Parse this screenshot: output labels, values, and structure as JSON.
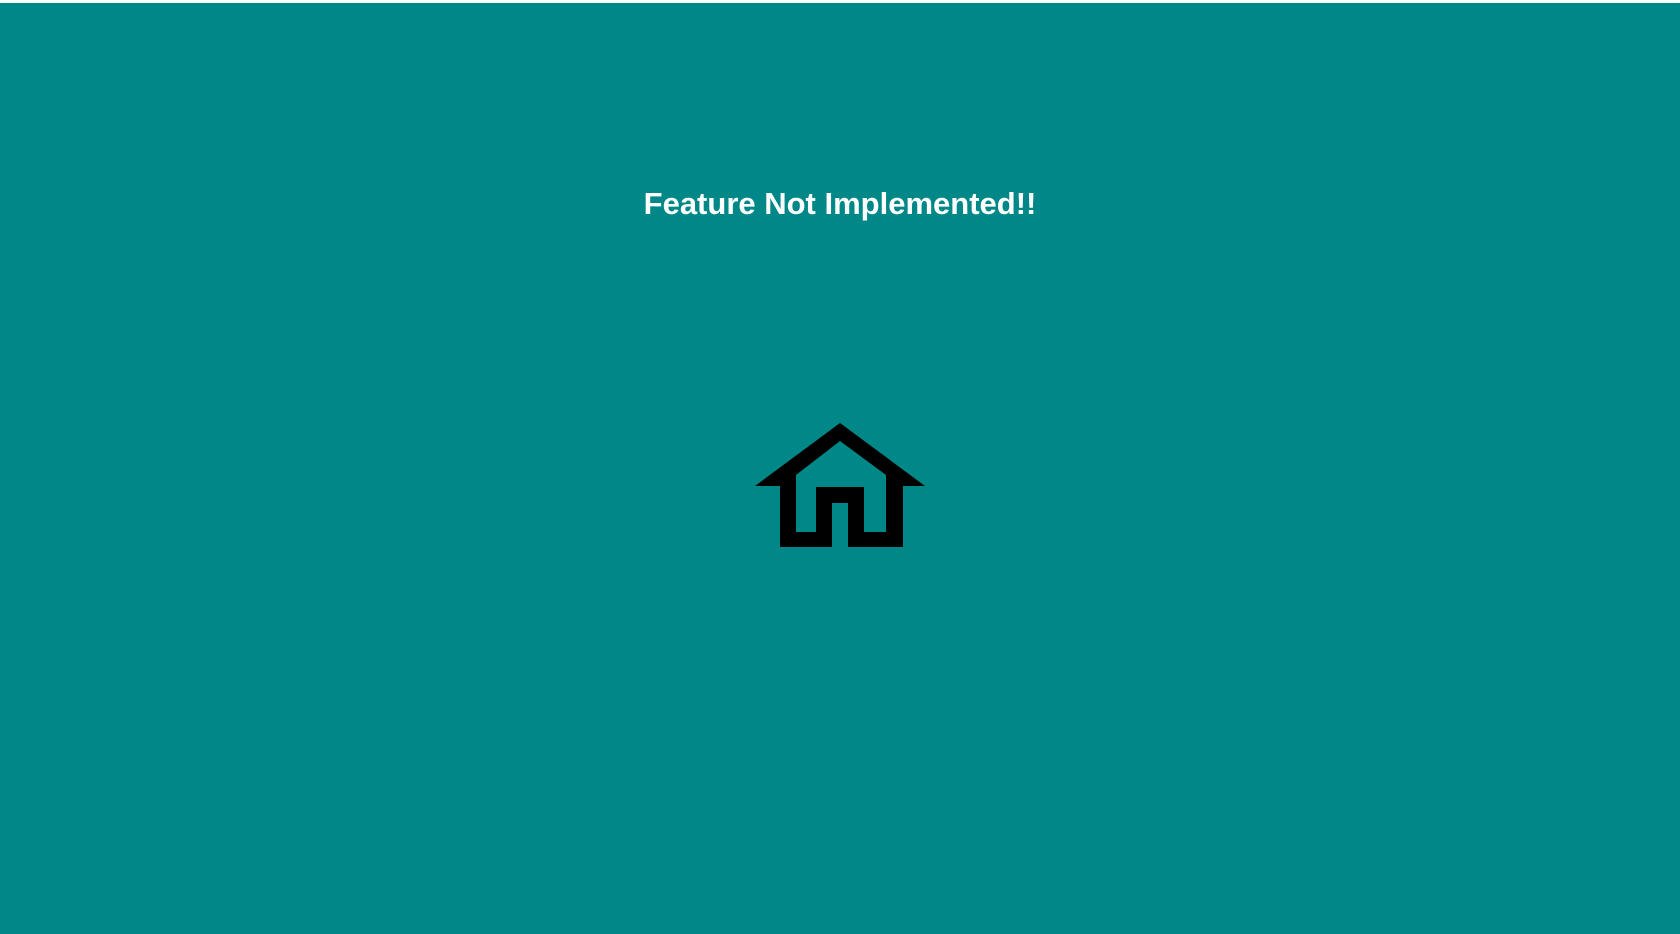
{
  "page": {
    "title": "Feature Not Implemented!!",
    "background_color": "#008888",
    "text_color": "#ffffff"
  },
  "home": {
    "icon": "home-icon",
    "icon_color": "#000000"
  }
}
